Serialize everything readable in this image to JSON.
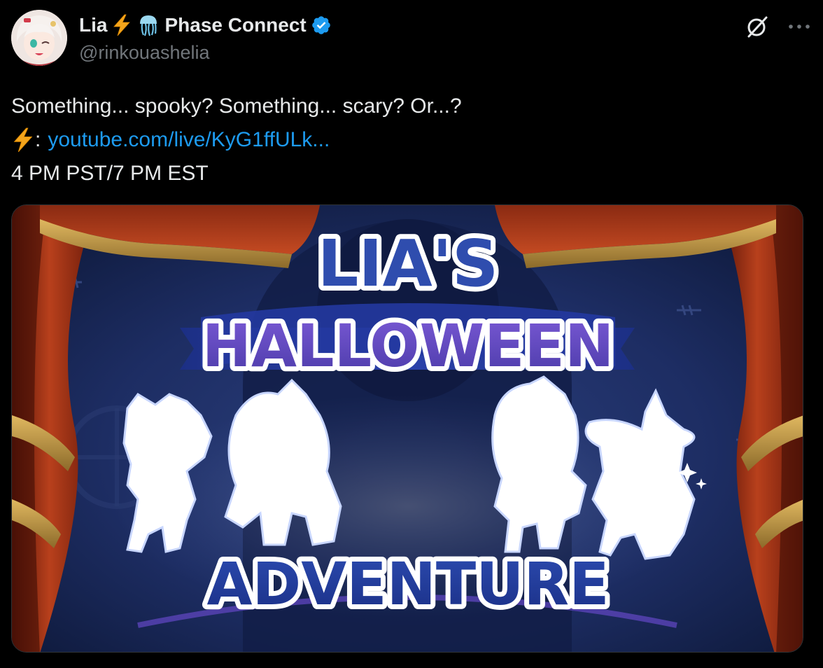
{
  "author": {
    "display_name": "Lia",
    "name_suffix": "Phase Connect",
    "handle": "@rinkouashelia",
    "verified_color": "#1d9bf0"
  },
  "icons": [
    "lightning-emoji",
    "jellyfish-emoji",
    "verified-badge-icon",
    "grok-icon",
    "more-icon"
  ],
  "tweet": {
    "line1": "Something... spooky? Something... scary? Or...?",
    "line2_suffix": ":",
    "link_text": "youtube.com/live/KyG1ffULk...",
    "line3": "4 PM PST/7 PM EST"
  },
  "media": {
    "title_top": "LIA'S",
    "title_mid": "HALLOWEEN",
    "title_bottom": "ADVENTURE"
  },
  "colors": {
    "background": "#000000",
    "text": "#e7e9ea",
    "secondary": "#71767b",
    "link": "#1d9bf0"
  }
}
